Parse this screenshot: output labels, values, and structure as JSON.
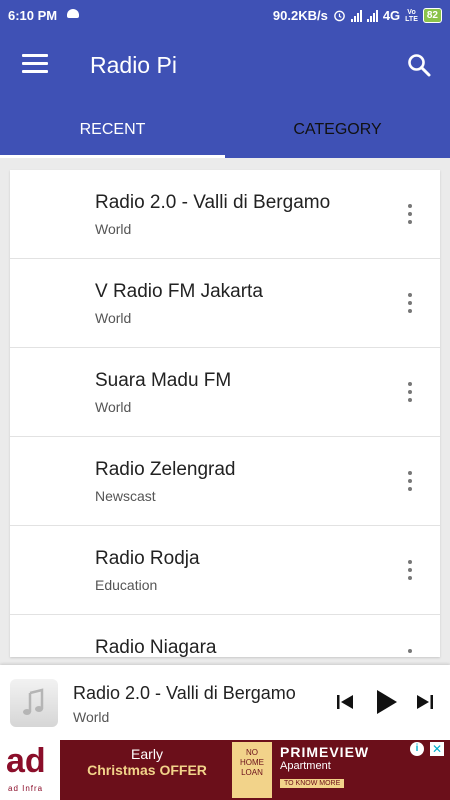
{
  "statusbar": {
    "time": "6:10 PM",
    "speed": "90.2KB/s",
    "network": "4G",
    "volte_top": "Vo",
    "volte_bottom": "LTE",
    "battery": "82"
  },
  "appbar": {
    "title": "Radio Pi",
    "menu_icon": "hamburger-menu-icon",
    "search_icon": "search-icon",
    "color": "#3f51b5"
  },
  "tabs": [
    {
      "label": "RECENT",
      "active": true
    },
    {
      "label": "CATEGORY",
      "active": false
    }
  ],
  "stations": [
    {
      "name": "Radio 2.0 - Valli di Bergamo",
      "category": "World"
    },
    {
      "name": "V Radio FM Jakarta",
      "category": "World"
    },
    {
      "name": "Suara Madu FM",
      "category": "World"
    },
    {
      "name": "Radio Zelengrad",
      "category": "Newscast"
    },
    {
      "name": "Radio Rodja",
      "category": "Education"
    },
    {
      "name": "Radio Niagara",
      "category": ""
    }
  ],
  "player": {
    "name": "Radio 2.0 - Valli di Bergamo",
    "category": "World",
    "art_icon": "music-note-icon",
    "controls": [
      "skip-previous-icon",
      "play-icon",
      "skip-next-icon"
    ]
  },
  "ad": {
    "brand_mark": "ad",
    "brand_name": "ad Infra",
    "offer_line1": "Early",
    "offer_line2": "Christmas OFFER",
    "box_text_1": "NO",
    "box_text_2": "HOME",
    "box_text_3": "LOAN",
    "prime_title": "PRIMEVIEW",
    "prime_sub": "Apartment",
    "prime_cta": "TO KNOW MORE",
    "choice_icon": "i",
    "close_icon": "✕"
  }
}
